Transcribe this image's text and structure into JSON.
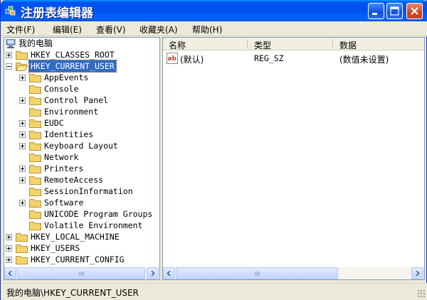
{
  "window": {
    "title": "注册表编辑器"
  },
  "menu": [
    {
      "label": "文件(F)"
    },
    {
      "label": "编辑(E)"
    },
    {
      "label": "查看(V)"
    },
    {
      "label": "收藏夹(A)"
    },
    {
      "label": "帮助(H)"
    }
  ],
  "tree": {
    "root_label": "我的电脑",
    "hives": [
      {
        "label": "HKEY_CLASSES_ROOT",
        "expander": "plus"
      },
      {
        "label": "HKEY_CURRENT_USER",
        "expander": "minus",
        "selected": true
      },
      {
        "label": "HKEY_LOCAL_MACHINE",
        "expander": "plus"
      },
      {
        "label": "HKEY_USERS",
        "expander": "plus"
      },
      {
        "label": "HKEY_CURRENT_CONFIG",
        "expander": "plus"
      }
    ],
    "current_user_children": [
      {
        "label": "AppEvents",
        "expander": "plus"
      },
      {
        "label": "Console",
        "expander": "none"
      },
      {
        "label": "Control Panel",
        "expander": "plus"
      },
      {
        "label": "Environment",
        "expander": "none"
      },
      {
        "label": "EUDC",
        "expander": "plus"
      },
      {
        "label": "Identities",
        "expander": "plus"
      },
      {
        "label": "Keyboard Layout",
        "expander": "plus"
      },
      {
        "label": "Network",
        "expander": "none"
      },
      {
        "label": "Printers",
        "expander": "plus"
      },
      {
        "label": "RemoteAccess",
        "expander": "plus"
      },
      {
        "label": "SessionInformation",
        "expander": "none"
      },
      {
        "label": "Software",
        "expander": "plus"
      },
      {
        "label": "UNICODE Program Groups",
        "expander": "none"
      },
      {
        "label": "Volatile Environment",
        "expander": "none"
      }
    ]
  },
  "list": {
    "columns": [
      "名称",
      "类型",
      "数据"
    ],
    "rows": [
      {
        "name": "(默认)",
        "type": "REG_SZ",
        "data": "(数值未设置)",
        "icon": "string-value-icon"
      }
    ]
  },
  "statusbar": {
    "path": "我的电脑\\HKEY_CURRENT_USER"
  },
  "colors": {
    "title_blue": "#0053EE",
    "selection": "#316AC5",
    "folder": "#F4D36B"
  }
}
